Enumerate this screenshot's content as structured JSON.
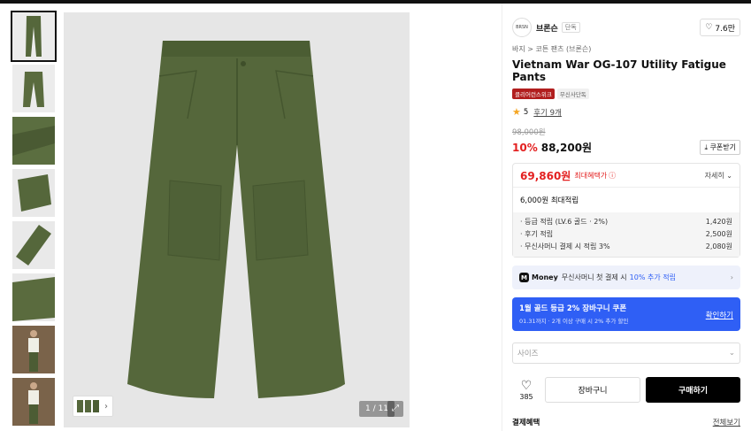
{
  "colors": {
    "accent": "#2f5ff5",
    "sale": "#e32020",
    "product_olive": "#55673b"
  },
  "gallery": {
    "thumbnails": [
      "pants-front",
      "pants-folded",
      "pants-detail",
      "pants-pocket",
      "pants-hem",
      "pants-waist",
      "model-front",
      "model-side"
    ],
    "counter": "1 / 11",
    "expand_icon": "expand-icon"
  },
  "brand": {
    "logo": "BRSN",
    "name": "브론슨",
    "tag": "단독",
    "likes": "7.6만"
  },
  "breadcrumb": "바지 > 코튼 팬츠 (브론슨)",
  "title": "Vietnam War OG-107 Utility Fatigue Pants",
  "badges": [
    "클리어런스위크",
    "무신사단독"
  ],
  "rating": {
    "score": "5",
    "reviews": "후기 9개"
  },
  "price": {
    "original": "98,000원",
    "discount": "10%",
    "sale": "88,200원",
    "coupon_btn": "쿠폰받기"
  },
  "benefit": {
    "best_price": "69,860원",
    "best_label": "최대혜택가",
    "detail_link": "자세히",
    "points_title": "6,000원 최대적립",
    "points": [
      {
        "label": "· 등급 적립 (LV.6 골드 · 2%)",
        "value": "1,420원"
      },
      {
        "label": "· 후기 적립",
        "value": "2,500원"
      },
      {
        "label": "· 무신사머니 결제 시 적립 3%",
        "value": "2,080원"
      }
    ]
  },
  "money_banner": {
    "logo": "M",
    "name": "Money",
    "text": "무신사머니 첫 결제 시",
    "highlight": "10% 추가 적립"
  },
  "coupon_banner": {
    "title": "1월 골드 등급 2% 장바구니 쿠폰",
    "sub": "01.31까지 · 2개 이상 구매 시 2% 추가 할인",
    "link": "확인하기"
  },
  "size_select": {
    "placeholder": "사이즈"
  },
  "actions": {
    "likes": "385",
    "cart": "장바구니",
    "buy": "구매하기"
  },
  "payment": {
    "title": "결제혜택",
    "all": "전체보기"
  }
}
